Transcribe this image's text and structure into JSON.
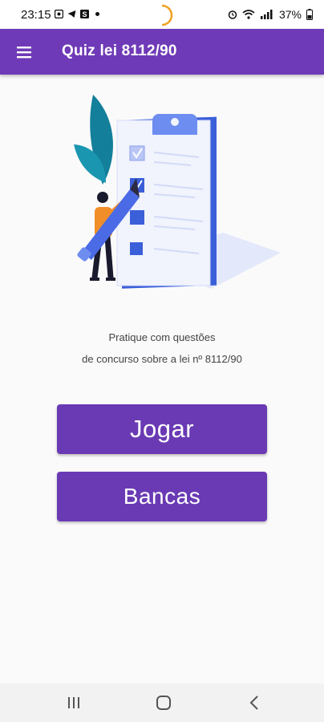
{
  "status_bar": {
    "time": "23:15",
    "battery": "37%",
    "icons": [
      "gallery-icon",
      "telegram-icon",
      "s-icon",
      "alarm-icon",
      "wifi-icon",
      "signal-icon"
    ]
  },
  "app_bar": {
    "title": "Quiz lei 8112/90",
    "menu_icon": "hamburger-menu-icon",
    "color": "#6f3ab7"
  },
  "main": {
    "description_line1": "Pratique com questões",
    "description_line2": "de concurso sobre a lei nº 8112/90",
    "buttons": {
      "play_label": "Jogar",
      "banks_label": "Bancas"
    },
    "button_color": "#6a3ab4"
  },
  "nav_bar": {
    "icons": [
      "recents-icon",
      "home-icon",
      "back-icon"
    ]
  }
}
